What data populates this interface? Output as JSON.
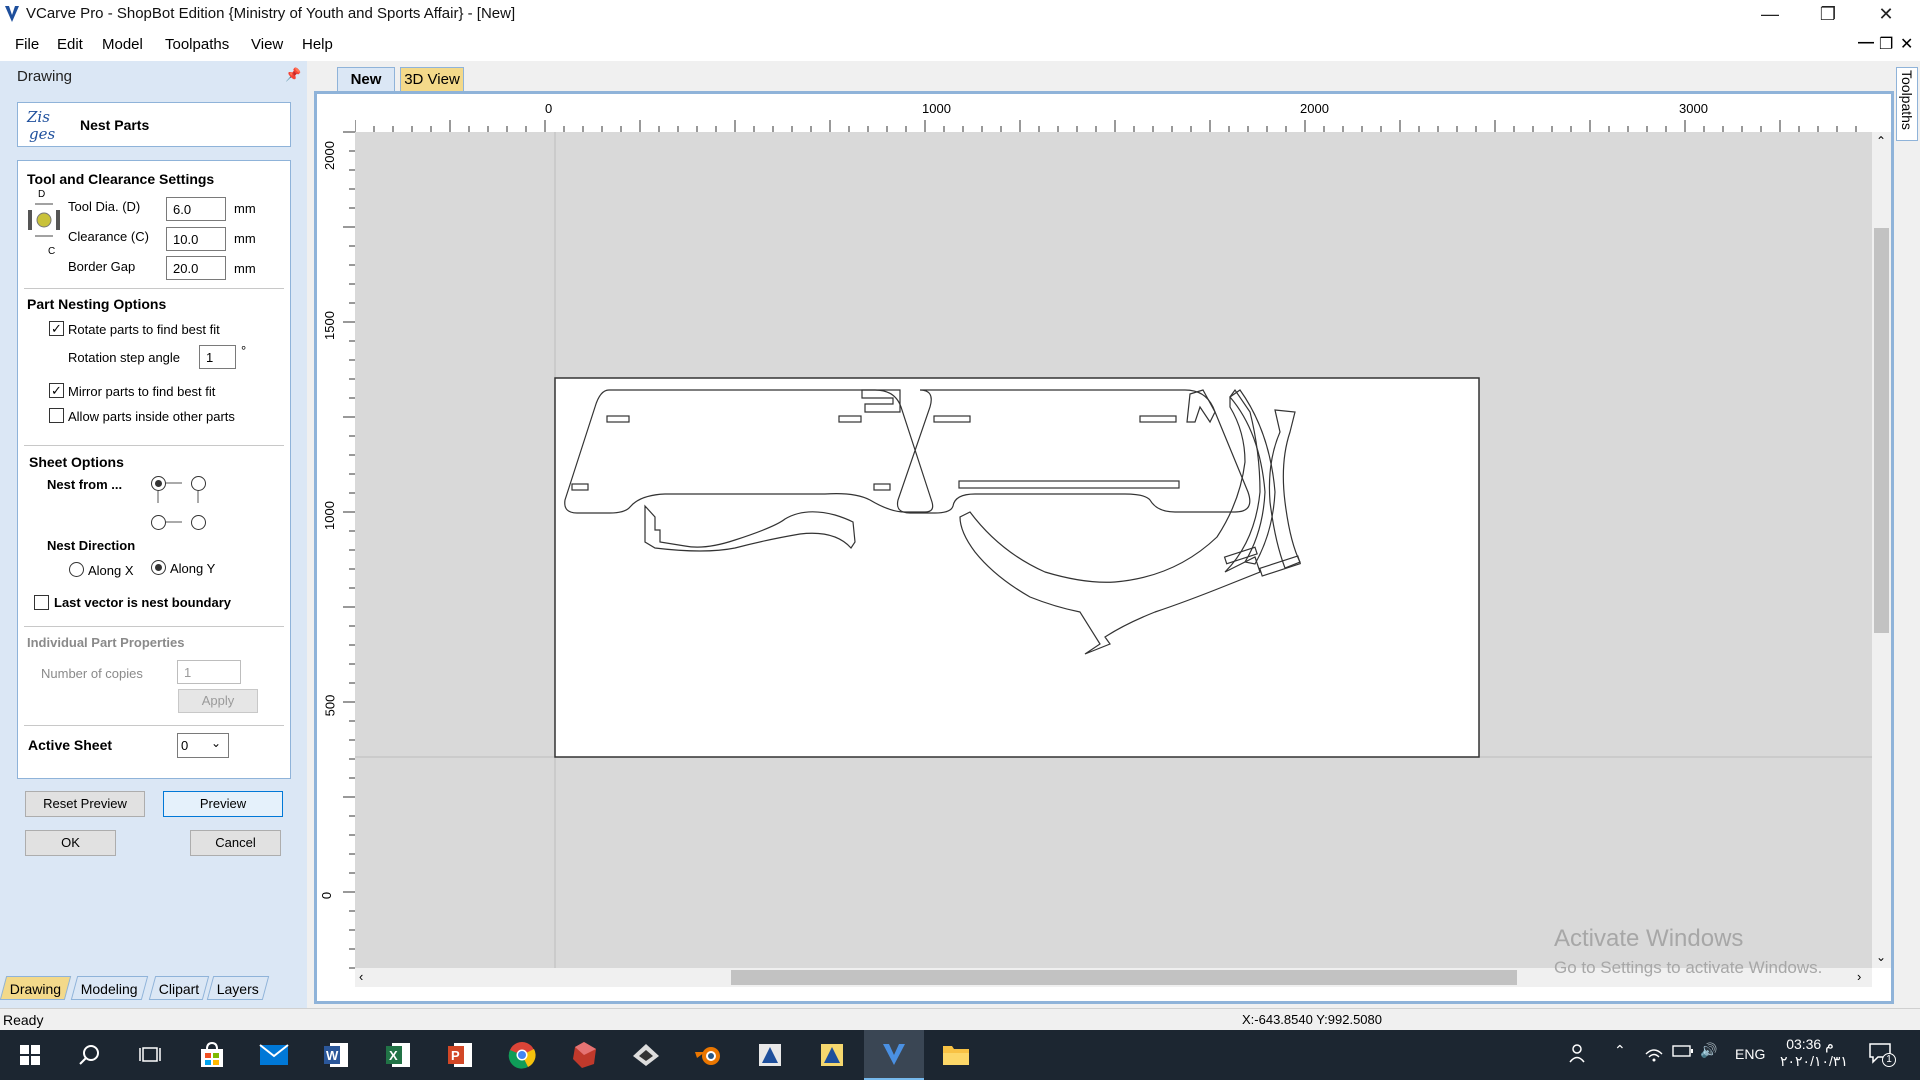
{
  "window": {
    "title": "VCarve Pro - ShopBot Edition {Ministry of Youth and Sports Affair} - [New]"
  },
  "menu": [
    "File",
    "Edit",
    "Model",
    "Toolpaths",
    "View",
    "Help"
  ],
  "panel": {
    "title": "Drawing",
    "header": "Nest Parts",
    "tool_settings": {
      "title": "Tool and Clearance Settings",
      "tool_dia_label": "Tool Dia. (D)",
      "tool_dia_value": "6.0",
      "clearance_label": "Clearance (C)",
      "clearance_value": "10.0",
      "border_gap_label": "Border Gap",
      "border_gap_value": "20.0",
      "unit": "mm",
      "diagram_d": "D",
      "diagram_c": "C"
    },
    "nesting": {
      "title": "Part Nesting Options",
      "rotate_label": "Rotate parts to find best fit",
      "rotate_checked": true,
      "rotation_step_label": "Rotation step angle",
      "rotation_step_value": "1",
      "degree": "°",
      "mirror_label": "Mirror parts to find best fit",
      "mirror_checked": true,
      "allow_inside_label": "Allow parts inside other parts",
      "allow_inside_checked": false
    },
    "sheet": {
      "title": "Sheet Options",
      "nest_from_label": "Nest from ...",
      "nest_direction_label": "Nest Direction",
      "along_x": "Along X",
      "along_y": "Along Y",
      "direction_selected": "Along Y",
      "last_vector_label": "Last vector is nest boundary",
      "last_vector_checked": false
    },
    "individual": {
      "title": "Individual Part Properties",
      "copies_label": "Number of copies",
      "copies_value": "1",
      "apply": "Apply"
    },
    "active_sheet": {
      "label": "Active Sheet",
      "value": "0"
    },
    "buttons": {
      "reset_preview": "Reset Preview",
      "preview": "Preview",
      "ok": "OK",
      "cancel": "Cancel"
    },
    "bottom_tabs": [
      "Drawing",
      "Modeling",
      "Clipart",
      "Layers"
    ]
  },
  "doc_tabs": {
    "new": "New",
    "view3d": "3D View"
  },
  "ruler": {
    "top_labels": [
      "0",
      "1000",
      "2000",
      "3000"
    ],
    "left_labels": [
      "2000",
      "1500",
      "1000",
      "500",
      "0"
    ]
  },
  "right_tab": "Toolpaths",
  "watermark": {
    "line1": "Activate Windows",
    "line2": "Go to Settings to activate Windows."
  },
  "status": {
    "text": "Ready",
    "coords": "X:-643.8540 Y:992.5080"
  },
  "taskbar": {
    "lang": "ENG",
    "time": "03:36 م",
    "date": "٢٠٢٠/١٠/٣١",
    "notifications": "1"
  },
  "colors": {
    "panel_bg": "#dbe7f5",
    "frame_border": "#8fb3d9",
    "taskbar": "#1c2631",
    "active_tab": "#f3d98a"
  }
}
